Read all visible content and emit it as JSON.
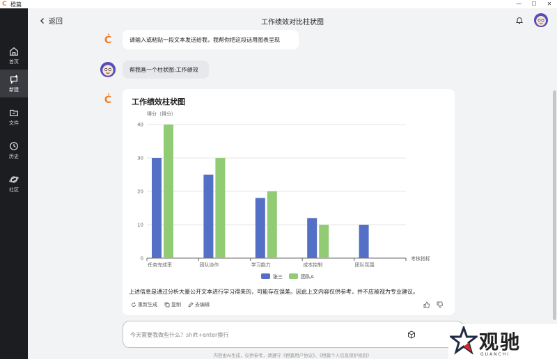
{
  "app": {
    "name": "橙篇",
    "title": "工作绩效对比柱状图"
  },
  "window_controls": [
    "—",
    "☐",
    "✕"
  ],
  "sidebar": {
    "items": [
      {
        "label": "首页",
        "icon": "home-icon"
      },
      {
        "label": "新建",
        "icon": "new-chat-icon",
        "active": true
      },
      {
        "label": "文件",
        "icon": "folder-icon"
      },
      {
        "label": "历史",
        "icon": "clock-icon"
      },
      {
        "label": "社区",
        "icon": "planet-icon"
      }
    ]
  },
  "header": {
    "back_label": "返回"
  },
  "messages": [
    {
      "role": "assistant",
      "text": "请输入或粘贴一段文本发送给我，我帮你把这段话用图表呈现"
    },
    {
      "role": "user",
      "text": "帮我画一个柱状图:工作绩效"
    }
  ],
  "card": {
    "disclaimer": "上述信息是通过分析大量公开文本进行学习得来的，可能存在误差。因此上文内容仅供参考，并不应被视为专业建议。",
    "actions": {
      "regenerate": "重新生成",
      "copy": "复制",
      "edit": "去编辑"
    }
  },
  "chart_data": {
    "type": "bar",
    "title": "工作绩效柱状图",
    "xlabel": "考核指标",
    "ylabel": "得分（得分）",
    "categories": [
      "任务完成率",
      "团队协作",
      "学习能力",
      "成本控制",
      "团队氛围"
    ],
    "x_tick_labels_shown": [
      "任务完成率",
      "团队协作",
      "学习能力",
      "成本控制",
      "团队氛围"
    ],
    "ylim": [
      0,
      40
    ],
    "yticks": [
      0,
      10,
      20,
      30,
      40
    ],
    "grid": true,
    "legend_position": "bottom",
    "series": [
      {
        "name": "张三",
        "color": "#5470c6",
        "values": [
          30,
          25,
          18,
          12,
          10
        ]
      },
      {
        "name": "团队A",
        "color": "#91cc75",
        "values": [
          40,
          30,
          20,
          10,
          null
        ]
      }
    ]
  },
  "input": {
    "placeholder": "今天需要我做些什么？shift+enter换行"
  },
  "footer": {
    "note": "内容由AI生成，仅供参考，请遵守《橙篇用户协议》、《橙篇个人信息保护规则》"
  },
  "watermark": {
    "text": "观驰",
    "sub": "GUANCHI"
  }
}
